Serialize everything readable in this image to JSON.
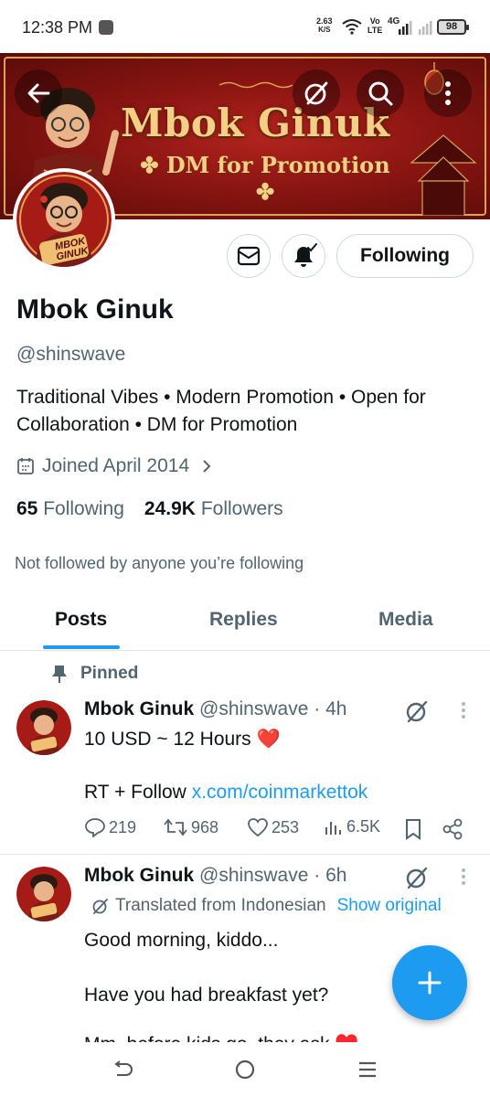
{
  "status_bar": {
    "time": "12:38 PM",
    "net_speed": "2.63",
    "net_unit": "K/S",
    "volte_top": "Vo",
    "volte_bottom": "LTE",
    "network": "4G",
    "battery": "98"
  },
  "banner": {
    "title": "Mbok Ginuk",
    "subtitle": "DM for Promotion",
    "colors": {
      "background": "#8a1512",
      "text": "#f4cf86"
    }
  },
  "top_nav": {
    "back_icon": "back-arrow-icon",
    "grok_icon": "grok-icon",
    "search_icon": "search-icon",
    "more_icon": "more-vertical-icon"
  },
  "profile": {
    "avatar_label": "MBOK GINUK",
    "display_name": "Mbok Ginuk",
    "handle": "@shinswave",
    "bio": "Traditional Vibes • Modern Promotion • Open for Collaboration • DM for Promotion",
    "joined": "Joined April 2014",
    "following_count": "65",
    "following_label": "Following",
    "followers_count": "24.9K",
    "followers_label": "Followers",
    "not_followed": "Not followed by anyone you’re following",
    "follow_button": "Following"
  },
  "tabs": [
    {
      "label": "Posts",
      "active": true
    },
    {
      "label": "Replies",
      "active": false
    },
    {
      "label": "Media",
      "active": false
    }
  ],
  "posts": [
    {
      "pinned_label": "Pinned",
      "name": "Mbok Ginuk",
      "handle": "@shinswave",
      "sep": "·",
      "time": "4h",
      "line1": "10 USD ~ 12 Hours ❤️",
      "line2_prefix": "RT + Follow ",
      "line2_link": "x.com/coinmarkettok",
      "replies": "219",
      "reposts": "968",
      "likes": "253",
      "views": "6.5K"
    },
    {
      "name": "Mbok Ginuk",
      "handle": "@shinswave",
      "sep": "·",
      "time": "6h",
      "translated": "Translated from Indonesian",
      "show_original": "Show original",
      "line1": "Good morning, kiddo...",
      "line2": "Have you had breakfast yet?",
      "line3": "Mm, before kids go, they ask ♥️"
    }
  ],
  "accent_color": "#1d9bf0"
}
